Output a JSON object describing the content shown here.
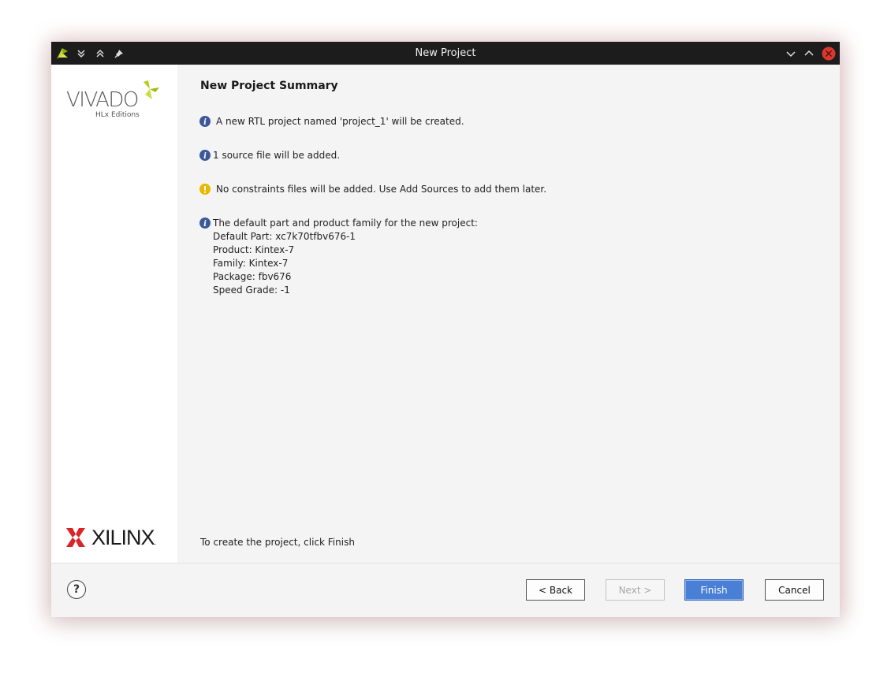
{
  "window": {
    "title": "New Project"
  },
  "sidebar": {
    "vivado_logo_text": "VIVADO",
    "vivado_logo_subtext": "HLx Editions",
    "xilinx_logo_text": "XILINX",
    "xilinx_logo_suffix": "."
  },
  "content": {
    "heading": "New Project Summary",
    "messages": [
      {
        "type": "info",
        "text": "A new RTL project named 'project_1' will be created."
      },
      {
        "type": "info",
        "text": "1 source file will be added."
      },
      {
        "type": "warning",
        "text": "No constraints files will be added. Use Add Sources to add them later."
      },
      {
        "type": "info",
        "text": "The default part and product family for the new project:",
        "details": [
          "Default Part: xc7k70tfbv676-1",
          "Product: Kintex-7",
          "Family: Kintex-7",
          "Package: fbv676",
          "Speed Grade: -1"
        ]
      }
    ],
    "footer_text": "To create the project, click Finish"
  },
  "buttons": {
    "help": "?",
    "back": "< Back",
    "next": "Next >",
    "finish": "Finish",
    "cancel": "Cancel"
  },
  "colors": {
    "titlebar": "#1c1c1c",
    "info_icon": "#3b5898",
    "warning_icon": "#e9b800",
    "close_button": "#d9382f",
    "primary_button": "#4a7fd6",
    "vivado_mark": "#b5cc18"
  },
  "icons": {
    "titlebar_app": "vivado-app-icon",
    "titlebar_left": [
      "collapse-down-icon",
      "expand-up-icon",
      "pin-icon"
    ],
    "titlebar_right": [
      "minimize-chevron-icon",
      "maximize-chevron-icon",
      "close-icon"
    ]
  }
}
